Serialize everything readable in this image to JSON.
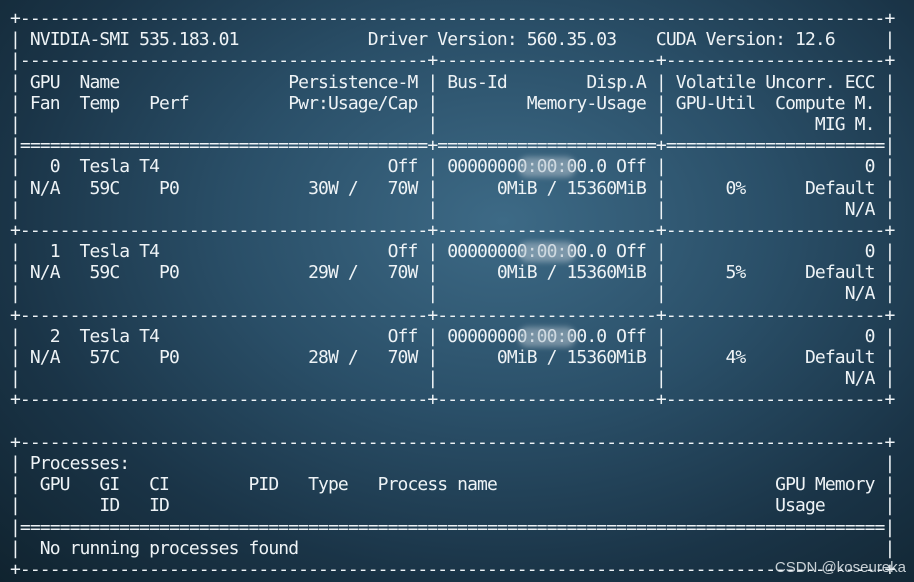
{
  "terminal": {
    "lines": [
      "+---------------------------------------------------------------------------------------+",
      "| NVIDIA-SMI 535.183.01             Driver Version: 560.35.03    CUDA Version: 12.6     |",
      "|-----------------------------------------+----------------------+----------------------+",
      "| GPU  Name                 Persistence-M | Bus-Id        Disp.A | Volatile Uncorr. ECC |",
      "| Fan  Temp   Perf          Pwr:Usage/Cap |         Memory-Usage | GPU-Util  Compute M. |",
      "|                                         |                      |               MIG M. |",
      "|=========================================+======================+======================|",
      "|   0  Tesla T4                       Off | 00000000:00:00.0 Off |                    0 |",
      "| N/A   59C    P0             30W /   70W |      0MiB / 15360MiB |      0%      Default |",
      "|                                         |                      |                  N/A |",
      "+-----------------------------------------+----------------------+----------------------+",
      "|   1  Tesla T4                       Off | 00000000:00:00.0 Off |                    0 |",
      "| N/A   59C    P0             29W /   70W |      0MiB / 15360MiB |      5%      Default |",
      "|                                         |                      |                  N/A |",
      "+-----------------------------------------+----------------------+----------------------+",
      "|   2  Tesla T4                       Off | 00000000:00:00.0 Off |                    0 |",
      "| N/A   57C    P0             28W /   70W |      0MiB / 15360MiB |      4%      Default |",
      "|                                         |                      |                  N/A |",
      "+-----------------------------------------+----------------------+----------------------+",
      "",
      "+---------------------------------------------------------------------------------------+",
      "| Processes:                                                                            |",
      "|  GPU   GI   CI        PID   Type   Process name                            GPU Memory |",
      "|        ID   ID                                                             Usage      |",
      "|=======================================================================================|",
      "|  No running processes found                                                           |",
      "+---------------------------------------------------------------------------------------+"
    ]
  },
  "watermark": "CSDN @koseureka"
}
